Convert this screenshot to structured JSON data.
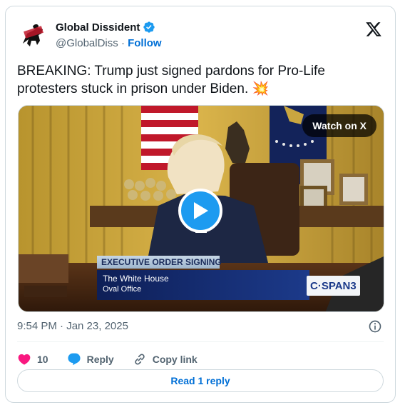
{
  "author": {
    "display_name": "Global Dissident",
    "handle": "@GlobalDiss",
    "separator": "·",
    "follow_label": "Follow",
    "avatar_icon": "horse-rider-logo",
    "verified_icon": "verified-badge-icon",
    "brand_logo_icon": "x-logo-icon"
  },
  "tweet": {
    "text": "BREAKING: Trump just signed pardons for Pro-Life protesters stuck in prison under Biden.",
    "emoji": "💥",
    "timestamp": "9:54 PM · Jan 23, 2025"
  },
  "media": {
    "watch_label": "Watch on X",
    "play_icon": "play-icon",
    "banner_title": "EXECUTIVE ORDER SIGNING",
    "location_line1": "The White House",
    "location_line2": "Oval Office",
    "network_logo": "C·SPAN3"
  },
  "actions": {
    "like_count": "10",
    "reply_label": "Reply",
    "copy_link_label": "Copy link"
  },
  "read_replies_label": "Read 1 reply",
  "colors": {
    "accent": "#1d9bf0",
    "like": "#f91880",
    "link": "#006fd6",
    "muted": "#536471",
    "border": "#cfd9de"
  }
}
